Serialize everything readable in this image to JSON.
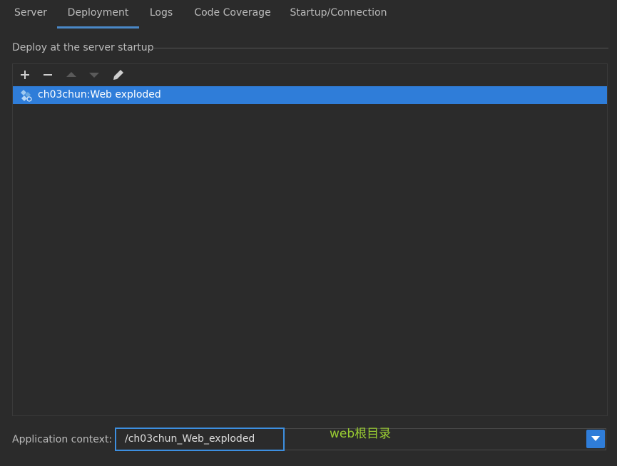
{
  "tabs": [
    {
      "label": "Server",
      "active": false
    },
    {
      "label": "Deployment",
      "active": true
    },
    {
      "label": "Logs",
      "active": false
    },
    {
      "label": "Code Coverage",
      "active": false
    },
    {
      "label": "Startup/Connection",
      "active": false
    }
  ],
  "deploy": {
    "section_title": "Deploy at the server startup",
    "toolbar": {
      "icons": [
        "add-icon",
        "remove-icon",
        "move-up-icon",
        "move-down-icon",
        "edit-icon"
      ]
    },
    "items": [
      {
        "label": "ch03chun:Web exploded",
        "selected": true,
        "icon": "artifact-icon"
      }
    ]
  },
  "context": {
    "label": "Application context:",
    "value": "/ch03chun_Web_exploded"
  },
  "annotation": {
    "text": "web根目录",
    "color": "#9acd32"
  },
  "colors": {
    "background": "#2b2b2b",
    "accent": "#2f7dd9",
    "tab_indicator": "#4a88c7",
    "focus_border": "#3d8fe0"
  }
}
